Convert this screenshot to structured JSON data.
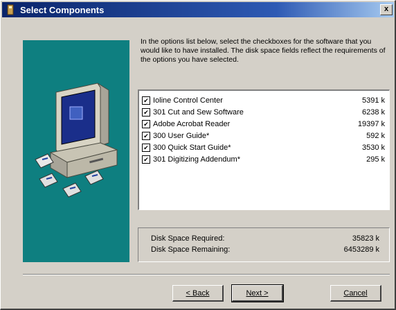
{
  "window": {
    "title": "Select Components",
    "close_label": "x"
  },
  "instructions": "In the options list below, select the checkboxes for the software that you would like to have installed. The disk space fields reflect the requirements of the options you have selected.",
  "components": [
    {
      "label": "Ioline Control Center",
      "size": "5391 k",
      "checked": true
    },
    {
      "label": "301 Cut and Sew Software",
      "size": "6238 k",
      "checked": true
    },
    {
      "label": "Adobe Acrobat Reader",
      "size": "19397 k",
      "checked": true
    },
    {
      "label": "300 User Guide*",
      "size": "592 k",
      "checked": true
    },
    {
      "label": "300 Quick Start Guide*",
      "size": "3530 k",
      "checked": true
    },
    {
      "label": "301 Digitizing Addendum*",
      "size": "295 k",
      "checked": true
    }
  ],
  "disk": {
    "required_label": "Disk Space Required:",
    "required_value": "35823 k",
    "remaining_label": "Disk Space Remaining:",
    "remaining_value": "6453289 k"
  },
  "buttons": {
    "back": "< Back",
    "next": "Next >",
    "cancel": "Cancel"
  },
  "colors": {
    "art_background": "#0e7f80",
    "title_bar": "#0a246a",
    "dialog": "#d4d0c8"
  },
  "icons": [
    "installer-icon",
    "computer-illustration-icon",
    "floppy-disk-icon"
  ]
}
